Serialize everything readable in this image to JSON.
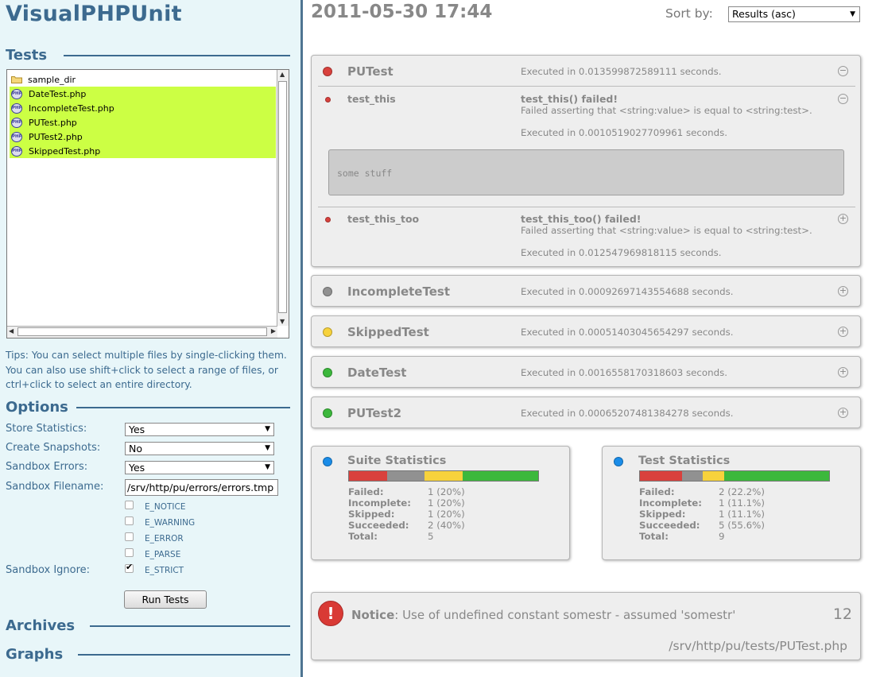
{
  "app": {
    "title": "VisualPHPUnit"
  },
  "sidebar": {
    "tests_heading": "Tests",
    "files": [
      {
        "name": "sample_dir",
        "type": "folder",
        "selected": false
      },
      {
        "name": "DateTest.php",
        "type": "php",
        "selected": true
      },
      {
        "name": "IncompleteTest.php",
        "type": "php",
        "selected": true
      },
      {
        "name": "PUTest.php",
        "type": "php",
        "selected": true
      },
      {
        "name": "PUTest2.php",
        "type": "php",
        "selected": true
      },
      {
        "name": "SkippedTest.php",
        "type": "php",
        "selected": true
      }
    ],
    "php_icon_text": "PHP",
    "tips": "Tips: You can select multiple files by single-clicking them. You can also use shift+click to select a range of files, or ctrl+click to select an entire directory.",
    "options_heading": "Options",
    "options": {
      "store_statistics": {
        "label": "Store Statistics:",
        "value": "Yes"
      },
      "create_snapshots": {
        "label": "Create Snapshots:",
        "value": "No"
      },
      "sandbox_errors": {
        "label": "Sandbox Errors:",
        "value": "Yes"
      },
      "sandbox_filename": {
        "label": "Sandbox Filename:",
        "value": "/srv/http/pu/errors/errors.tmp"
      },
      "sandbox_ignore": {
        "label": "Sandbox Ignore:"
      }
    },
    "ignore_flags": [
      {
        "label": "E_NOTICE",
        "checked": false
      },
      {
        "label": "E_WARNING",
        "checked": false
      },
      {
        "label": "E_ERROR",
        "checked": false
      },
      {
        "label": "E_PARSE",
        "checked": false
      },
      {
        "label": "E_STRICT",
        "checked": true
      }
    ],
    "run_button": "Run Tests",
    "archives_heading": "Archives",
    "graphs_heading": "Graphs"
  },
  "header": {
    "datetime": "2011-05-30 17:44",
    "sort_label": "Sort by:",
    "sort_value": "Results (asc)"
  },
  "suites": [
    {
      "name": "PUTest",
      "status": "failed",
      "exec": "Executed in 0.013599872589111 seconds.",
      "expanded": true,
      "tests": [
        {
          "name": "test_this",
          "status": "failed",
          "title": "test_this() failed!",
          "message": "Failed asserting that <string:value> is equal to <string:test>.",
          "exec": "Executed in 0.0010519027709961 seconds.",
          "output": "some stuff"
        },
        {
          "name": "test_this_too",
          "status": "failed",
          "title": "test_this_too() failed!",
          "message": "Failed asserting that <string:value> is equal to <string:test>.",
          "exec": "Executed in 0.012547969818115 seconds."
        }
      ]
    },
    {
      "name": "IncompleteTest",
      "status": "incomplete",
      "exec": "Executed in 0.00092697143554688 seconds."
    },
    {
      "name": "SkippedTest",
      "status": "skipped",
      "exec": "Executed in 0.00051403045654297 seconds."
    },
    {
      "name": "DateTest",
      "status": "succeeded",
      "exec": "Executed in 0.0016558170318603 seconds."
    },
    {
      "name": "PUTest2",
      "status": "succeeded",
      "exec": "Executed in 0.00065207481384278 seconds."
    }
  ],
  "toggle_icons": {
    "collapse": "−",
    "expand": "+"
  },
  "statistics": [
    {
      "title": "Suite Statistics",
      "failed": "1 (20%)",
      "incomplete": "1 (20%)",
      "skipped": "1 (20%)",
      "succeeded": "2 (40%)",
      "total": "5",
      "bar_fractions": {
        "failed": 0.2,
        "incomplete": 0.2,
        "skipped": 0.2,
        "succeeded": 0.4
      }
    },
    {
      "title": "Test Statistics",
      "failed": "2 (22.2%)",
      "incomplete": "1 (11.1%)",
      "skipped": "1 (11.1%)",
      "succeeded": "5 (55.6%)",
      "total": "9",
      "bar_fractions": {
        "failed": 0.222,
        "incomplete": 0.111,
        "skipped": 0.111,
        "succeeded": 0.556
      }
    }
  ],
  "stat_labels": {
    "failed": "Failed:",
    "incomplete": "Incomplete:",
    "skipped": "Skipped:",
    "succeeded": "Succeeded:",
    "total": "Total:"
  },
  "notice": {
    "icon_text": "!",
    "label": "Notice",
    "message": ": Use of undefined constant somestr - assumed 'somestr'",
    "line": "12",
    "file": "/srv/http/pu/tests/PUTest.php"
  },
  "colors": {
    "failed": "#d9413d",
    "incomplete": "#919191",
    "skipped": "#f7d23c",
    "succeeded": "#3cb83c",
    "stats": "#1a8ce8",
    "sidebar_text": "#3c6a8f"
  }
}
